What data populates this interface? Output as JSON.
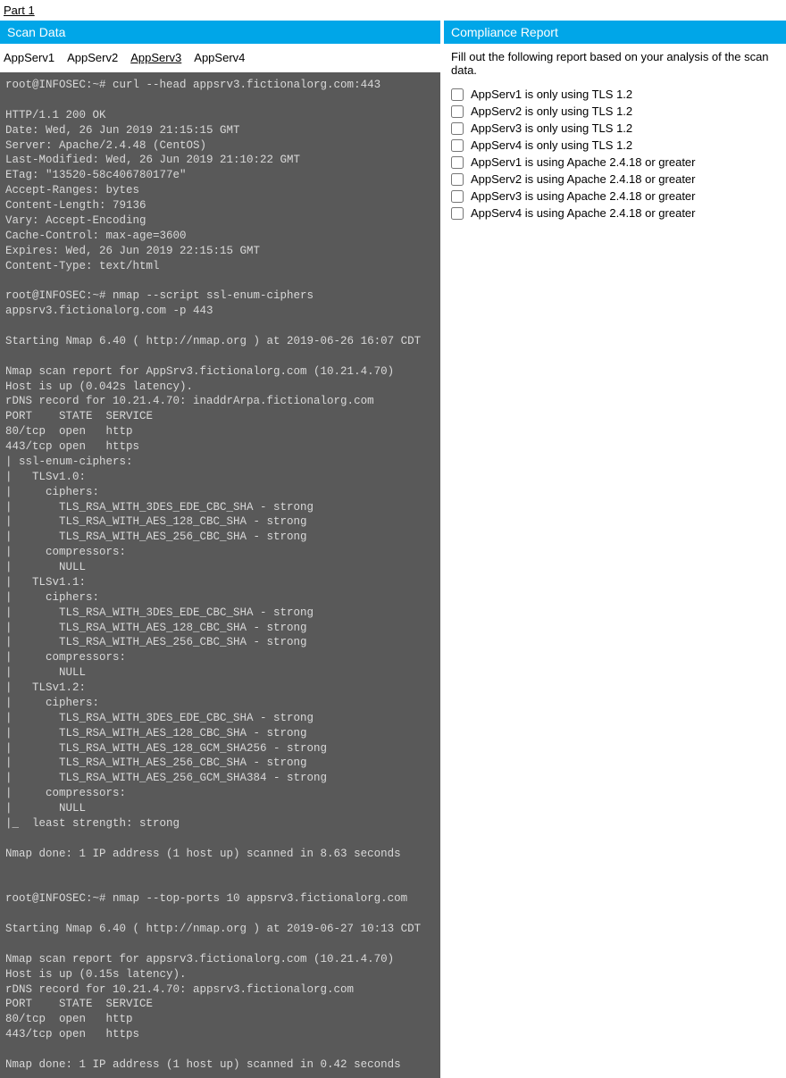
{
  "partLink": "Part 1",
  "scanData": {
    "header": "Scan Data",
    "tabs": [
      {
        "label": "AppServ1",
        "active": false
      },
      {
        "label": "AppServ2",
        "active": false
      },
      {
        "label": "AppServ3",
        "active": true
      },
      {
        "label": "AppServ4",
        "active": false
      }
    ],
    "terminal": "root@INFOSEC:~# curl --head appsrv3.fictionalorg.com:443\n\nHTTP/1.1 200 OK\nDate: Wed, 26 Jun 2019 21:15:15 GMT\nServer: Apache/2.4.48 (CentOS)\nLast-Modified: Wed, 26 Jun 2019 21:10:22 GMT\nETag: \"13520-58c406780177e\"\nAccept-Ranges: bytes\nContent-Length: 79136\nVary: Accept-Encoding\nCache-Control: max-age=3600\nExpires: Wed, 26 Jun 2019 22:15:15 GMT\nContent-Type: text/html\n\nroot@INFOSEC:~# nmap --script ssl-enum-ciphers\nappsrv3.fictionalorg.com -p 443\n\nStarting Nmap 6.40 ( http://nmap.org ) at 2019-06-26 16:07 CDT\n\nNmap scan report for AppSrv3.fictionalorg.com (10.21.4.70)\nHost is up (0.042s latency).\nrDNS record for 10.21.4.70: inaddrArpa.fictionalorg.com\nPORT    STATE  SERVICE\n80/tcp  open   http\n443/tcp open   https\n| ssl-enum-ciphers:\n|   TLSv1.0:\n|     ciphers:\n|       TLS_RSA_WITH_3DES_EDE_CBC_SHA - strong\n|       TLS_RSA_WITH_AES_128_CBC_SHA - strong\n|       TLS_RSA_WITH_AES_256_CBC_SHA - strong\n|     compressors:\n|       NULL\n|   TLSv1.1:\n|     ciphers:\n|       TLS_RSA_WITH_3DES_EDE_CBC_SHA - strong\n|       TLS_RSA_WITH_AES_128_CBC_SHA - strong\n|       TLS_RSA_WITH_AES_256_CBC_SHA - strong\n|     compressors:\n|       NULL\n|   TLSv1.2:\n|     ciphers:\n|       TLS_RSA_WITH_3DES_EDE_CBC_SHA - strong\n|       TLS_RSA_WITH_AES_128_CBC_SHA - strong\n|       TLS_RSA_WITH_AES_128_GCM_SHA256 - strong\n|       TLS_RSA_WITH_AES_256_CBC_SHA - strong\n|       TLS_RSA_WITH_AES_256_GCM_SHA384 - strong\n|     compressors:\n|       NULL\n|_  least strength: strong\n\nNmap done: 1 IP address (1 host up) scanned in 8.63 seconds\n\n\nroot@INFOSEC:~# nmap --top-ports 10 appsrv3.fictionalorg.com\n\nStarting Nmap 6.40 ( http://nmap.org ) at 2019-06-27 10:13 CDT\n\nNmap scan report for appsrv3.fictionalorg.com (10.21.4.70)\nHost is up (0.15s latency).\nrDNS record for 10.21.4.70: appsrv3.fictionalorg.com\nPORT    STATE  SERVICE\n80/tcp  open   http\n443/tcp open   https\n\nNmap done: 1 IP address (1 host up) scanned in 0.42 seconds"
  },
  "compliance": {
    "header": "Compliance Report",
    "instruction": "Fill out the following report based on your analysis of the scan data.",
    "items": [
      "AppServ1 is only using TLS 1.2",
      "AppServ2 is only using TLS 1.2",
      "AppServ3 is only using TLS 1.2",
      "AppServ4 is only using TLS 1.2",
      "AppServ1 is using Apache 2.4.18 or greater",
      "AppServ2 is using Apache 2.4.18 or greater",
      "AppServ3 is using Apache 2.4.18 or greater",
      "AppServ4 is using Apache 2.4.18 or greater"
    ]
  }
}
